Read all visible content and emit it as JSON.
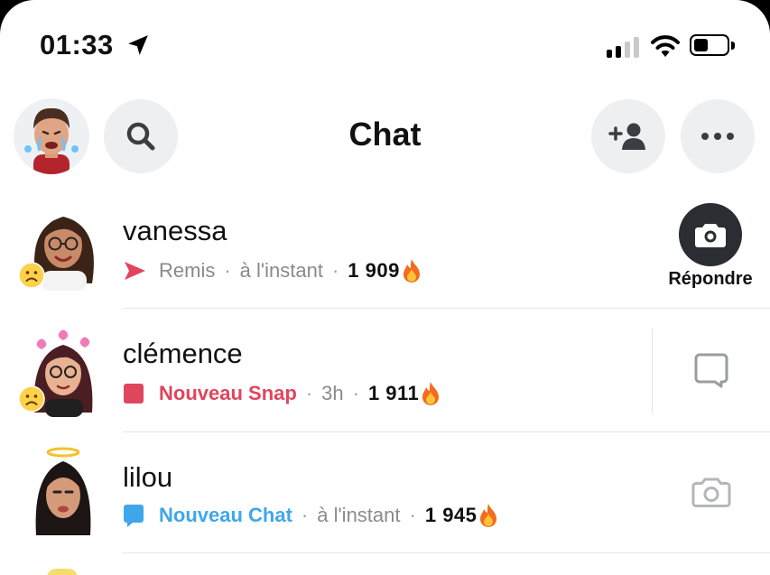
{
  "status_bar": {
    "time": "01:33",
    "location_icon": "location-arrow-icon",
    "signal_icon": "cellular-signal-icon",
    "signal_bars_active": 2,
    "signal_bars_total": 4,
    "wifi_icon": "wifi-icon",
    "battery_icon": "battery-icon",
    "battery_level": 0.45
  },
  "header": {
    "title": "Chat",
    "search_icon": "search-icon",
    "add_friend_icon": "add-friend-icon",
    "more_icon": "more-icon"
  },
  "chats": [
    {
      "name": "vanessa",
      "status_icon": "sent-arrow-icon",
      "status": "Remis",
      "time": "à l'instant",
      "streak": "1 909",
      "streak_icon": "fire-icon",
      "action_label": "Répondre",
      "action_icon": "camera-icon"
    },
    {
      "name": "clémence",
      "status_icon": "new-snap-square-icon",
      "status": "Nouveau Snap",
      "time": "3h",
      "streak": "1 911",
      "streak_icon": "fire-icon",
      "action_icon": "chat-bubble-icon"
    },
    {
      "name": "lilou",
      "status_icon": "new-chat-bubble-icon",
      "status": "Nouveau Chat",
      "time": "à l'instant",
      "streak": "1 945",
      "streak_icon": "fire-icon",
      "action_icon": "camera-icon"
    }
  ],
  "colors": {
    "snap_red": "#e0455e",
    "chat_blue": "#40a6ea",
    "secondary_text": "#8a8a8a",
    "button_bg": "#eeeff1"
  }
}
